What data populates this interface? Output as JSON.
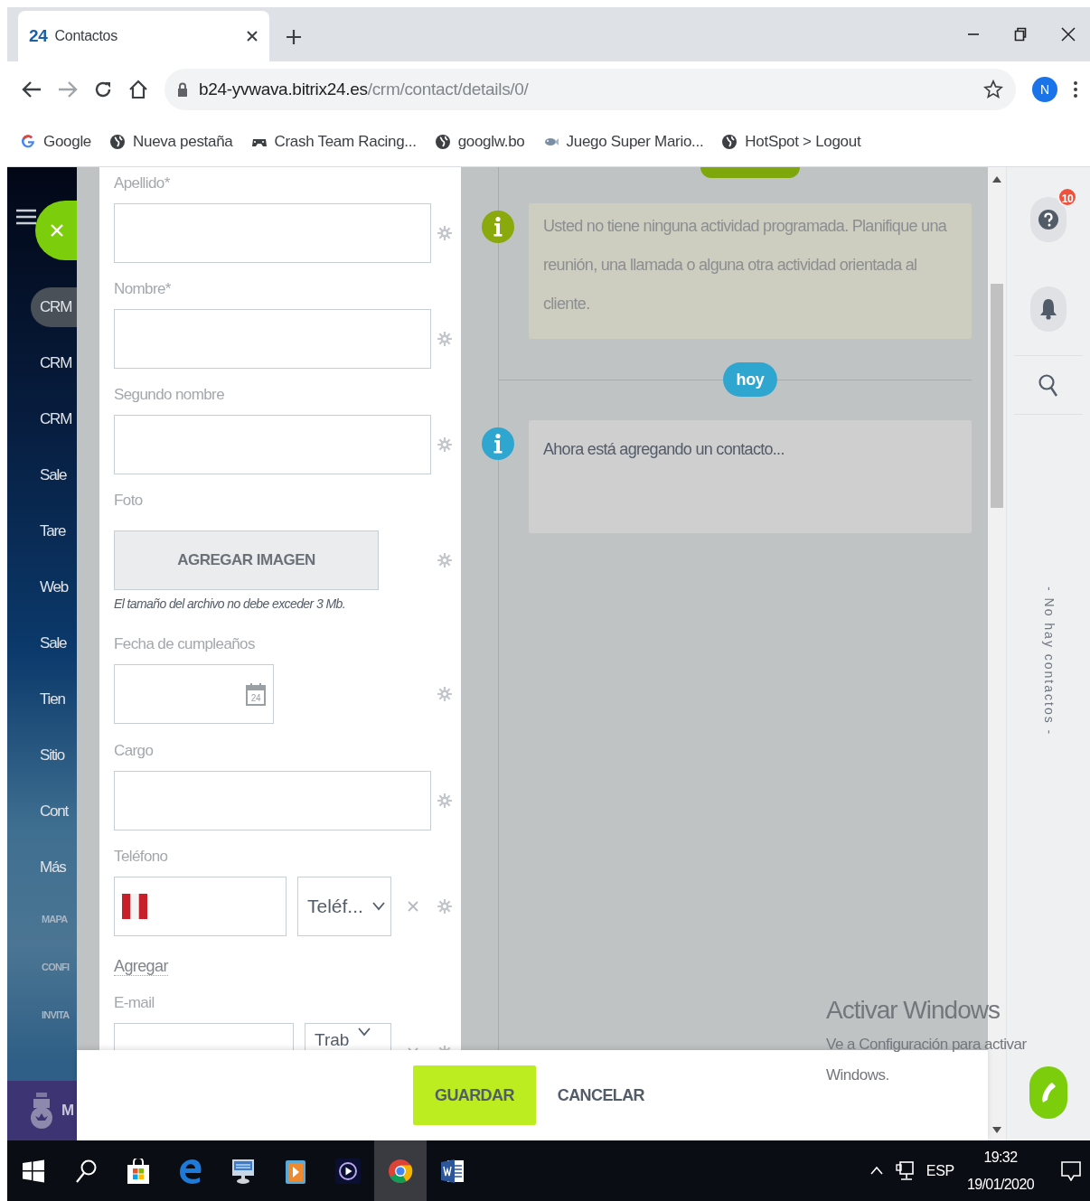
{
  "browser": {
    "tabs": [
      {
        "favicon": "24",
        "title": "Contactos",
        "selected": true
      }
    ],
    "url_host": "b24-yvwava.bitrix24.es",
    "url_path": "/crm/contact/details/0/",
    "profile": "N",
    "bookmarks": [
      {
        "kind": "google",
        "label": "Google"
      },
      {
        "kind": "globe",
        "label": "Nueva pestaña"
      },
      {
        "kind": "gamepad",
        "label": "Crash Team Racing..."
      },
      {
        "kind": "globe",
        "label": "googlw.bo"
      },
      {
        "kind": "game",
        "label": "Juego Super Mario..."
      },
      {
        "kind": "globe",
        "label": "HotSpot > Logout"
      }
    ]
  },
  "sidebar": {
    "items": [
      {
        "kind": "main",
        "label": "CRM",
        "selected": true
      },
      {
        "kind": "main",
        "label": "CRM",
        "selected": false
      },
      {
        "kind": "main",
        "label": "CRM",
        "selected": false
      },
      {
        "kind": "main",
        "label": "Sale",
        "selected": false
      },
      {
        "kind": "main",
        "label": "Tare",
        "selected": false
      },
      {
        "kind": "main",
        "label": "Web",
        "selected": false
      },
      {
        "kind": "main",
        "label": "Sale",
        "selected": false
      },
      {
        "kind": "main",
        "label": "Tien",
        "selected": false
      },
      {
        "kind": "main",
        "label": "Sitio",
        "selected": false
      },
      {
        "kind": "main",
        "label": "Cont",
        "selected": false
      },
      {
        "kind": "main",
        "label": "Más",
        "selected": false
      },
      {
        "kind": "small",
        "label": "MAPA",
        "selected": false
      },
      {
        "kind": "small",
        "label": "CONFI",
        "selected": false
      },
      {
        "kind": "small",
        "label": "INVITA",
        "selected": false
      }
    ],
    "user_initial": "M"
  },
  "form": {
    "fields": [
      {
        "kind": "text",
        "label": "Apellido*"
      },
      {
        "kind": "text",
        "label": "Nombre*"
      },
      {
        "kind": "text",
        "label": "Segundo nombre"
      },
      {
        "kind": "image",
        "label": "Foto",
        "button": "AGREGAR IMAGEN",
        "note": "El tamaño del archivo no debe exceder 3 Mb."
      },
      {
        "kind": "date",
        "label": "Fecha de cumpleaños",
        "calendar_day": "24"
      },
      {
        "kind": "text",
        "label": "Cargo"
      },
      {
        "kind": "phone",
        "label": "Teléfono",
        "type": "Teléf..."
      },
      {
        "kind": "link",
        "label": "Agregar"
      },
      {
        "kind": "email",
        "label": "E-mail",
        "type": "Trab"
      }
    ]
  },
  "timeline": {
    "items": [
      {
        "kind": "notice",
        "color": "#8aa90c",
        "text": "Usted no tiene ninguna actividad programada. Planifique una reunión, una llamada o alguna otra actividad orientada al cliente."
      },
      {
        "kind": "divider",
        "label": "hoy"
      },
      {
        "kind": "info",
        "color": "#2fa6d0",
        "text": "Ahora está agregando un contacto..."
      }
    ]
  },
  "right_panel": {
    "help_badge": "10",
    "contacts_empty": "- No hay contactos -"
  },
  "footer": {
    "buttons": [
      {
        "kind": "primary",
        "label": "GUARDAR"
      },
      {
        "kind": "plain",
        "label": "CANCELAR"
      }
    ]
  },
  "os_notice": {
    "title": "Activar Windows",
    "text": "Ve a Configuración para activar Windows."
  },
  "taskbar": {
    "apps": [
      {
        "kind": "start",
        "selected": false
      },
      {
        "kind": "search",
        "selected": false
      },
      {
        "kind": "store",
        "selected": false
      },
      {
        "kind": "edge",
        "selected": false
      },
      {
        "kind": "remote",
        "selected": false
      },
      {
        "kind": "media",
        "selected": false
      },
      {
        "kind": "player",
        "selected": false
      },
      {
        "kind": "chrome",
        "selected": true
      },
      {
        "kind": "word",
        "selected": false
      }
    ],
    "language": "ESP",
    "time": "19:32",
    "date": "19/01/2020"
  }
}
